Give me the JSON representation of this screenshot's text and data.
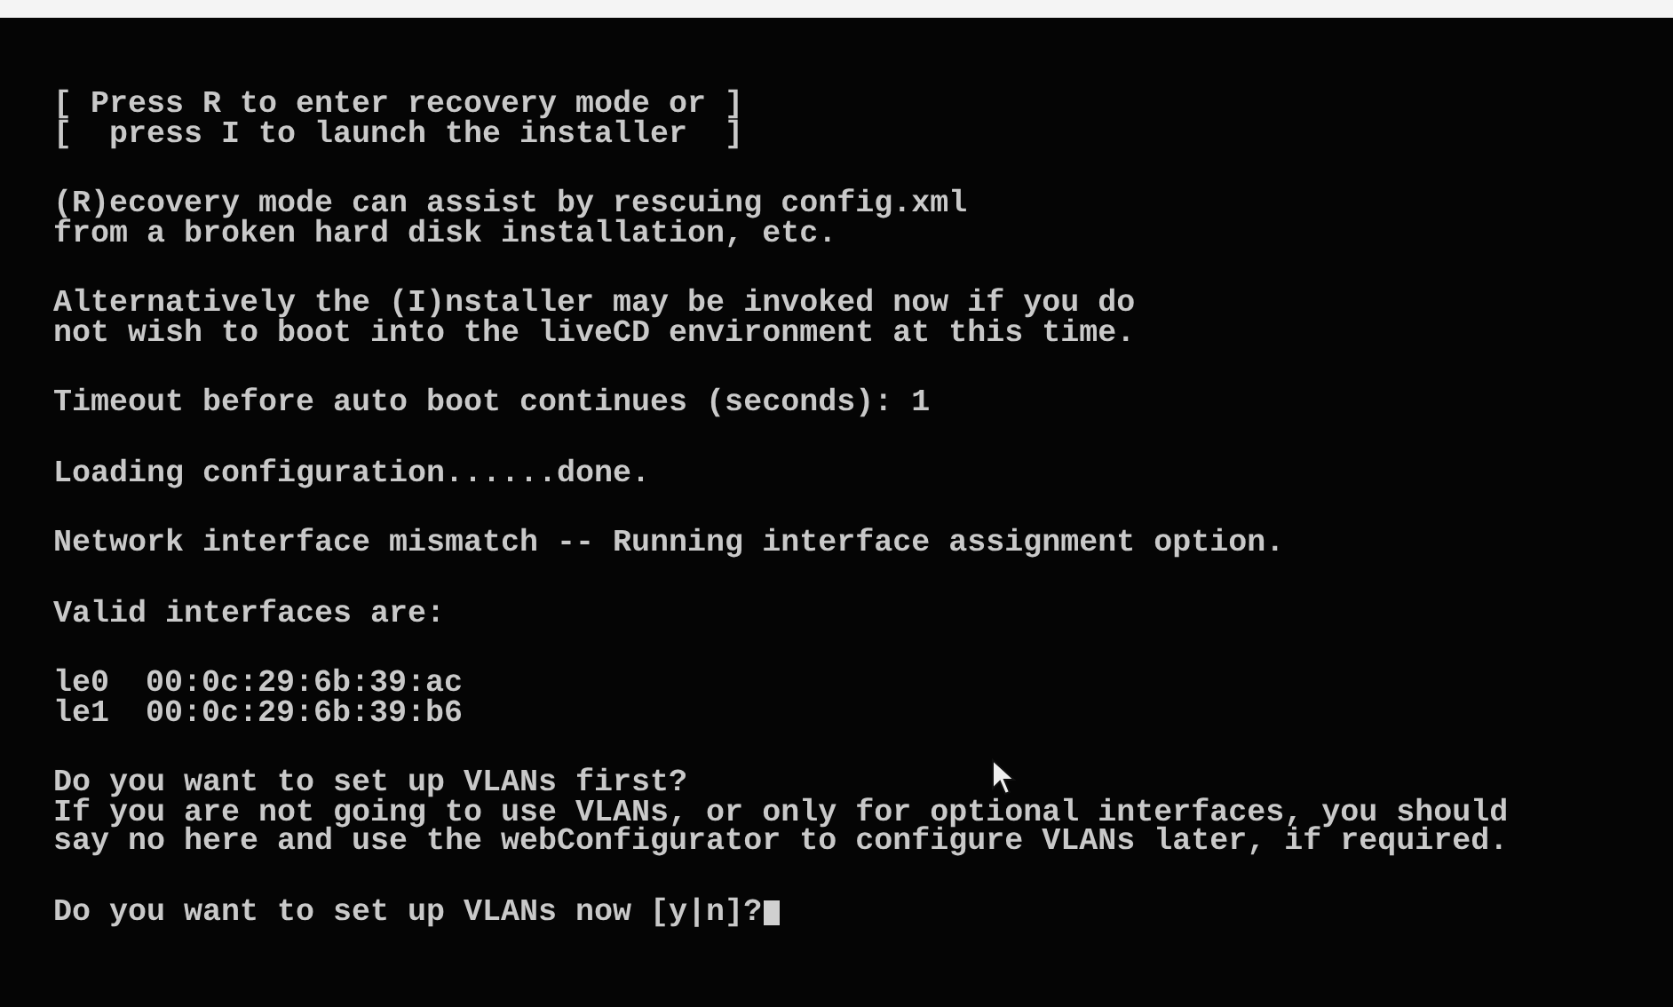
{
  "console": {
    "blocks": [
      {
        "kind": "text",
        "lines": [
          "[ Press R to enter recovery mode or ]",
          "[  press I to launch the installer  ]"
        ]
      },
      {
        "kind": "text",
        "lines": [
          "(R)ecovery mode can assist by rescuing config.xml",
          "from a broken hard disk installation, etc."
        ]
      },
      {
        "kind": "text",
        "lines": [
          "Alternatively the (I)nstaller may be invoked now if you do",
          "not wish to boot into the liveCD environment at this time."
        ]
      },
      {
        "kind": "text",
        "lines": [
          "Timeout before auto boot continues (seconds): 1"
        ]
      },
      {
        "kind": "text",
        "lines": [
          "Loading configuration......done."
        ]
      },
      {
        "kind": "text",
        "lines": [
          "Network interface mismatch -- Running interface assignment option."
        ]
      },
      {
        "kind": "text",
        "lines": [
          "Valid interfaces are:"
        ]
      },
      {
        "kind": "interfaces",
        "rows": [
          {
            "name": "le0",
            "mac": "00:0c:29:6b:39:ac"
          },
          {
            "name": "le1",
            "mac": "00:0c:29:6b:39:b6"
          }
        ]
      },
      {
        "kind": "text",
        "lines": [
          "Do you want to set up VLANs first?",
          "If you are not going to use VLANs, or only for optional interfaces, you should",
          "say no here and use the webConfigurator to configure VLANs later, if required."
        ]
      },
      {
        "kind": "prompt",
        "text": "Do you want to set up VLANs now [y|n]?"
      }
    ]
  }
}
